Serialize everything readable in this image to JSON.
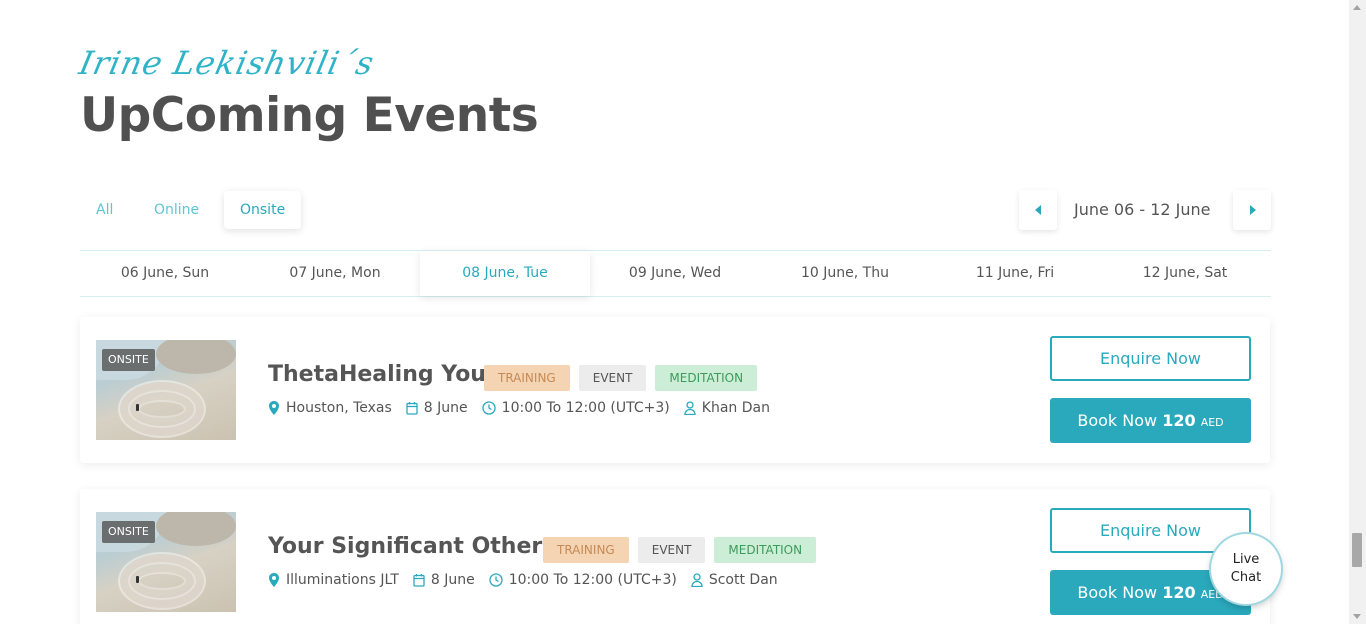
{
  "header": {
    "script_title": "Irine Lekishvili´s",
    "main_title": "UpComing Events"
  },
  "filters": {
    "tabs": [
      {
        "label": "All"
      },
      {
        "label": "Online"
      },
      {
        "label": "Onsite"
      }
    ],
    "active": "Onsite"
  },
  "week_nav": {
    "label": "June 06 - 12 June",
    "prev_icon": "triangle-left-icon",
    "next_icon": "triangle-right-icon"
  },
  "days": [
    {
      "label": "06 June, Sun"
    },
    {
      "label": "07 June, Mon"
    },
    {
      "label": "08 June, Tue"
    },
    {
      "label": "09 June, Wed"
    },
    {
      "label": "10 June, Thu"
    },
    {
      "label": "11 June, Fri"
    },
    {
      "label": "12 June, Sat"
    }
  ],
  "active_day": "08 June, Tue",
  "events": [
    {
      "badge": "ONSITE",
      "title": "ThetaHealing You",
      "tags": [
        "TRAINING",
        "EVENT",
        "MEDITATION"
      ],
      "location": "Houston, Texas",
      "date": "8 June",
      "time": "10:00 To 12:00 (UTC+3)",
      "host": "Khan Dan",
      "enquire_label": "Enquire Now",
      "book_label": "Book Now",
      "price": "120",
      "currency": "AED"
    },
    {
      "badge": "ONSITE",
      "title": "Your Significant Others",
      "tags": [
        "TRAINING",
        "EVENT",
        "MEDITATION"
      ],
      "location": "Illuminations JLT",
      "date": "8 June",
      "time": "10:00 To 12:00 (UTC+3)",
      "host": "Scott Dan",
      "enquire_label": "Enquire Now",
      "book_label": "Book Now",
      "price": "120",
      "currency": "AED"
    }
  ],
  "live_chat": {
    "line1": "Live",
    "line2": "Chat"
  },
  "colors": {
    "accent": "#2aa9bd",
    "title": "#505050",
    "tag_training_bg": "#f5d4b3",
    "tag_event_bg": "#ececec",
    "tag_meditation_bg": "#cdeed6"
  }
}
